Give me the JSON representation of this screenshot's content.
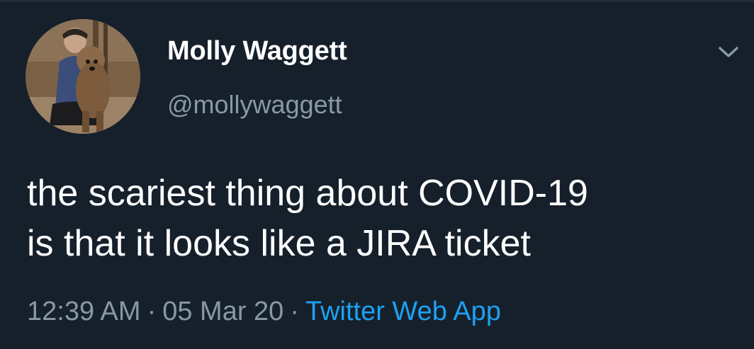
{
  "author": {
    "display_name": "Molly Waggett",
    "handle": "@mollywaggett"
  },
  "tweet": {
    "text_lines": [
      "the scariest thing about COVID-19",
      "is that it looks like a JIRA ticket"
    ],
    "time": "12:39 AM",
    "date": "05 Mar 20",
    "separator": "·",
    "source": "Twitter Web App"
  },
  "icons": {
    "menu": "chevron-down-icon",
    "avatar": "profile-photo-with-dog"
  },
  "colors": {
    "background": "#15202b",
    "primary_text": "#ffffff",
    "secondary_text": "#8899a6",
    "link": "#1da1f2"
  }
}
